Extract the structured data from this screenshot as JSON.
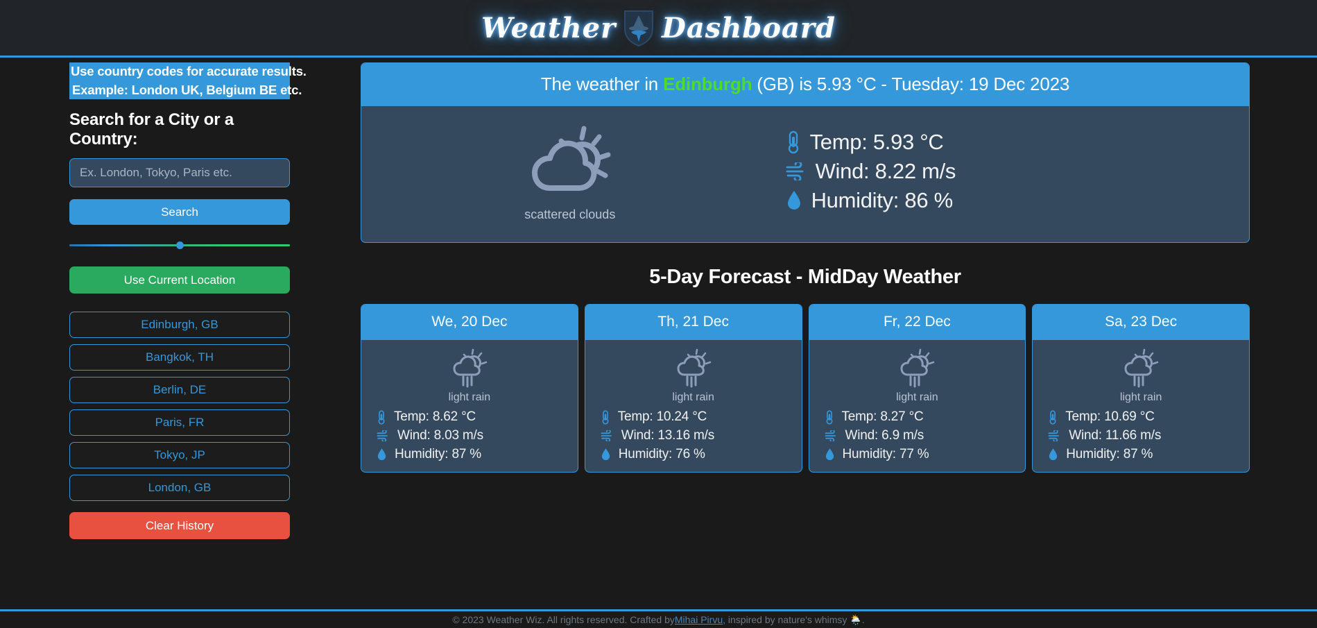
{
  "header": {
    "title_part1": "Weather",
    "title_part2": "Dashboard",
    "badge_icon": "wizard-shield-icon"
  },
  "sidebar": {
    "hints": [
      "Use country codes for accurate results.",
      "Example: London UK, Belgium BE etc."
    ],
    "search_label": "Search for a City or a Country:",
    "search_placeholder": "Ex. London, Tokyo, Paris etc.",
    "search_value": "",
    "search_button": "Search",
    "location_button": "Use Current Location",
    "history": [
      "Edinburgh, GB",
      "Bangkok, TH",
      "Berlin, DE",
      "Paris, FR",
      "Tokyo, JP",
      "London, GB"
    ],
    "clear_button": "Clear History"
  },
  "current": {
    "headline_prefix": "The weather in ",
    "city": "Edinburgh",
    "headline_suffix": " (GB) is 5.93 °C - Tuesday: 19 Dec 2023",
    "icon": "cloud-sun-icon",
    "description": "scattered clouds",
    "stats": [
      {
        "icon": "thermometer-icon",
        "text": "Temp: 5.93 °C"
      },
      {
        "icon": "wind-icon",
        "text": "Wind: 8.22 m/s"
      },
      {
        "icon": "droplet-icon",
        "text": "Humidity: 86 %"
      }
    ]
  },
  "forecast": {
    "title": "5-Day Forecast - MidDay Weather",
    "cards": [
      {
        "day": "We, 20 Dec",
        "icon": "rain-sun-icon",
        "description": "light rain",
        "temp": "Temp: 8.62 °C",
        "wind": "Wind: 8.03 m/s",
        "humidity": "Humidity: 87 %"
      },
      {
        "day": "Th, 21 Dec",
        "icon": "rain-sun-icon",
        "description": "light rain",
        "temp": "Temp: 10.24 °C",
        "wind": "Wind: 13.16 m/s",
        "humidity": "Humidity: 76 %"
      },
      {
        "day": "Fr, 22 Dec",
        "icon": "rain-sun-icon",
        "description": "light rain",
        "temp": "Temp: 8.27 °C",
        "wind": "Wind: 6.9 m/s",
        "humidity": "Humidity: 77 %"
      },
      {
        "day": "Sa, 23 Dec",
        "icon": "rain-sun-icon",
        "description": "light rain",
        "temp": "Temp: 10.69 °C",
        "wind": "Wind: 11.66 m/s",
        "humidity": "Humidity: 87 %"
      }
    ]
  },
  "footer": {
    "text_before": "© 2023 Weather Wiz. All rights reserved. Crafted by ",
    "author": "Mihai Pirvu",
    "text_after": ", inspired by nature's whimsy 🌦️."
  },
  "colors": {
    "accent_blue": "#3498db",
    "card_slate": "#34495e",
    "green": "#2aaa5e",
    "red": "#e8503f",
    "city_green": "#4ddb2c",
    "page_bg": "#1a1a1a"
  }
}
